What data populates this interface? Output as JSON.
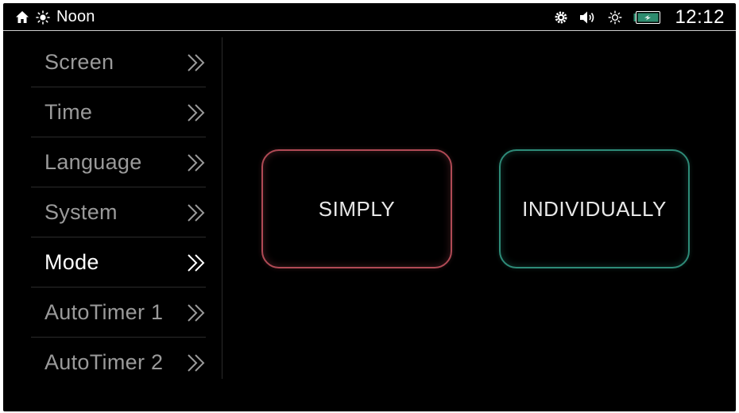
{
  "status_bar": {
    "time_of_day": "Noon",
    "clock": "12:12",
    "icons": [
      "home-icon",
      "sun-icon",
      "gear-icon",
      "volume-icon",
      "brightness-icon",
      "battery-icon"
    ]
  },
  "sidebar": {
    "items": [
      {
        "label": "Screen",
        "active": false
      },
      {
        "label": "Time",
        "active": false
      },
      {
        "label": "Language",
        "active": false
      },
      {
        "label": "System",
        "active": false
      },
      {
        "label": "Mode",
        "active": true
      },
      {
        "label": "AutoTimer 1",
        "active": false
      },
      {
        "label": "AutoTimer 2",
        "active": false
      }
    ]
  },
  "main": {
    "buttons": [
      {
        "label": "SIMPLY",
        "accent": "#b04a55"
      },
      {
        "label": "INDIVIDUALLY",
        "accent": "#2e8b78"
      }
    ]
  },
  "colors": {
    "background": "#000000",
    "text_active": "#ffffff",
    "text_inactive": "#9a9a9a",
    "battery": "#2e8b6e"
  }
}
